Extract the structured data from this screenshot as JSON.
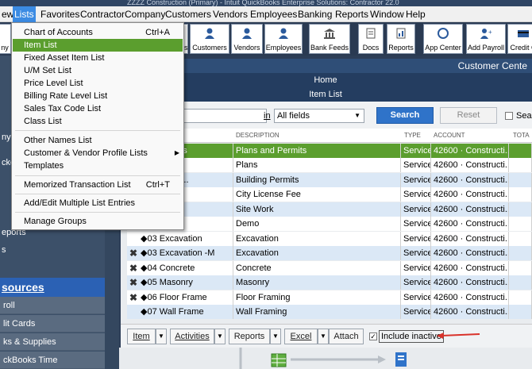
{
  "title_text": "ZZZZ Construction (Primary) - Intuit QuickBooks Enterprise Solutions: Contractor 22.0",
  "menubar": {
    "items": [
      "ew",
      "Lists",
      "Favorites",
      "Contractor",
      "Company",
      "Customers",
      "Vendors",
      "Employees",
      "Banking",
      "Reports",
      "Window",
      "Help"
    ]
  },
  "toolbar": {
    "items": [
      "Customers",
      "Vendors",
      "Employees",
      "Bank Feeds",
      "Docs",
      "Reports",
      "App Center",
      "Add Payroll",
      "Credit C"
    ],
    "partial_left": "ny",
    "partial_or": "or",
    "partial_s": "s"
  },
  "lists_menu": {
    "items": [
      {
        "label": "Chart of Accounts",
        "shortcut": "Ctrl+A"
      },
      {
        "label": "Item List",
        "shortcut": ""
      },
      {
        "label": "Fixed Asset Item List",
        "shortcut": ""
      },
      {
        "label": "U/M Set List",
        "shortcut": ""
      },
      {
        "label": "Price Level List",
        "shortcut": ""
      },
      {
        "label": "Billing Rate Level List",
        "shortcut": ""
      },
      {
        "label": "Sales Tax Code List",
        "shortcut": ""
      },
      {
        "label": "Class List",
        "shortcut": ""
      },
      {
        "label": "Other Names List",
        "shortcut": ""
      },
      {
        "label": "Customer & Vendor Profile Lists",
        "shortcut": ""
      },
      {
        "label": "Templates",
        "shortcut": ""
      },
      {
        "label": "Memorized Transaction List",
        "shortcut": "Ctrl+T"
      },
      {
        "label": "Add/Edit Multiple List Entries",
        "shortcut": ""
      },
      {
        "label": "Manage Groups",
        "shortcut": ""
      }
    ]
  },
  "left_panel": {
    "partial_top": "ny",
    "partial_2": "cke",
    "partial_reports": "eports",
    "partial_s": "s",
    "resources_label": "sources",
    "sub_items": [
      "roll",
      "lit Cards",
      "ks & Supplies",
      "ckBooks Time"
    ]
  },
  "center": {
    "customer_center": "Customer Cente",
    "home": "Home",
    "item_list_title": "Item List"
  },
  "filter": {
    "in_label": "in",
    "select_value": "All fields",
    "search_label": "Search",
    "reset_label": "Reset",
    "search_check_label": "Sear"
  },
  "columns": {
    "description": "DESCRIPTION",
    "type": "TYPE",
    "account": "ACCOUNT",
    "total": "TOTA"
  },
  "rows": [
    {
      "name": "and Permits",
      "desc": "Plans and Permits",
      "type": "Service",
      "acct": "42600 · Constructi...",
      "x": false,
      "style": "sel"
    },
    {
      "name": "lans",
      "desc": "Plans",
      "type": "Service",
      "acct": "42600 · Constructi...",
      "x": false,
      "style": "odd"
    },
    {
      "name": "uilding Per...",
      "desc": "Building Permits",
      "type": "Service",
      "acct": "42600 · Constructi...",
      "x": false,
      "style": "even"
    },
    {
      "name": "ity License",
      "desc": "City License Fee",
      "type": "Service",
      "acct": "42600 · Constructi...",
      "x": false,
      "style": "odd"
    },
    {
      "name": "ork",
      "desc": "Site Work",
      "type": "Service",
      "acct": "42600 · Constructi...",
      "x": false,
      "style": "even"
    },
    {
      "name": "Demo",
      "desc": "Demo",
      "type": "Service",
      "acct": "42600 · Constructi...",
      "x": false,
      "style": "odd"
    },
    {
      "name": "◆03 Excavation",
      "desc": "Excavation",
      "type": "Service",
      "acct": "42600 · Constructi...",
      "x": false,
      "style": "odd"
    },
    {
      "name": "◆03 Excavation -M",
      "desc": "Excavation",
      "type": "Service",
      "acct": "42600 · Constructi...",
      "x": true,
      "style": "even"
    },
    {
      "name": "◆04 Concrete",
      "desc": "Concrete",
      "type": "Service",
      "acct": "42600 · Constructi...",
      "x": true,
      "style": "odd"
    },
    {
      "name": "◆05 Masonry",
      "desc": "Masonry",
      "type": "Service",
      "acct": "42600 · Constructi...",
      "x": true,
      "style": "even"
    },
    {
      "name": "◆06 Floor Frame",
      "desc": "Floor Framing",
      "type": "Service",
      "acct": "42600 · Constructi...",
      "x": true,
      "style": "odd"
    },
    {
      "name": "◆07 Wall Frame",
      "desc": "Wall Framing",
      "type": "Service",
      "acct": "42600 · Constructi...",
      "x": false,
      "style": "even"
    }
  ],
  "bottom": {
    "item": "Item",
    "activities": "Activities",
    "reports": "Reports",
    "excel": "Excel",
    "attach": "Attach",
    "include_inactive": "Include inactive"
  },
  "colors": {
    "selected_green": "#5b9e2e",
    "row_blue": "#dbe8f6",
    "search_blue": "#2f73c9",
    "arrow_red": "#d9322a"
  }
}
